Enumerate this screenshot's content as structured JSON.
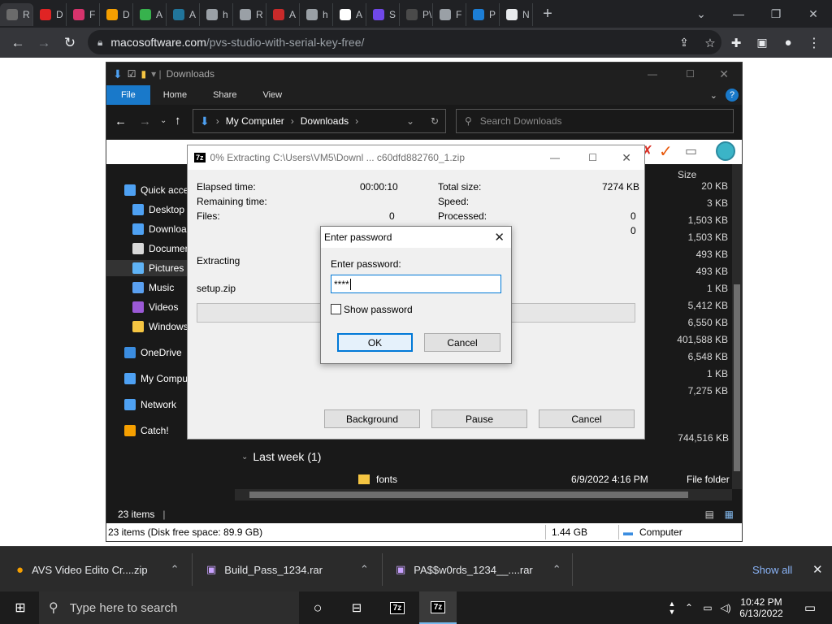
{
  "browser": {
    "tabs": [
      {
        "letter": "R",
        "color": "#6b6b6b"
      },
      {
        "letter": "D",
        "color": "#e02424"
      },
      {
        "letter": "F",
        "color": "#d6336c"
      },
      {
        "letter": "D",
        "color": "#f59f00"
      },
      {
        "letter": "A",
        "color": "#37b24d"
      },
      {
        "letter": "A",
        "color": "#21759b"
      },
      {
        "letter": "h",
        "color": "#9aa0a6"
      },
      {
        "letter": "R",
        "color": "#9aa0a6"
      },
      {
        "letter": "A",
        "color": "#c92a2a"
      },
      {
        "letter": "h",
        "color": "#9aa0a6"
      },
      {
        "letter": "A",
        "color": "#ffffff"
      },
      {
        "letter": "S",
        "color": "#7048e8"
      },
      {
        "letter": "P\\",
        "color": "#4a4a4a"
      },
      {
        "letter": "F",
        "color": "#9aa0a6"
      },
      {
        "letter": "P",
        "color": "#1c7ed6"
      },
      {
        "letter": "N",
        "color": "#e8eaed"
      }
    ],
    "new_tab": "+",
    "url_domain": "macosoftware.com",
    "url_path": "/pvs-studio-with-serial-key-free/"
  },
  "explorer": {
    "title": "Downloads",
    "ribbon": [
      "File",
      "Home",
      "Share",
      "View"
    ],
    "path": [
      "My Computer",
      "Downloads"
    ],
    "search_placeholder": "Search Downloads",
    "sidebar": [
      {
        "label": "Quick access",
        "color": "#4ea1f3"
      },
      {
        "label": "Desktop",
        "color": "#4ea1f3"
      },
      {
        "label": "Downloads",
        "color": "#4ea1f3"
      },
      {
        "label": "Documents",
        "color": "#d9d9d9"
      },
      {
        "label": "Pictures",
        "color": "#5fb3f6"
      },
      {
        "label": "Music",
        "color": "#5aa0f0"
      },
      {
        "label": "Videos",
        "color": "#9b59d6"
      },
      {
        "label": "Windows",
        "color": "#f5c542"
      },
      {
        "label": "OneDrive",
        "color": "#3b8de0"
      },
      {
        "label": "My Computer",
        "color": "#4ea1f3"
      },
      {
        "label": "Network",
        "color": "#4ea1f3"
      },
      {
        "label": "Catch!",
        "color": "#f59f00"
      }
    ],
    "size_header": "Size",
    "sizes": [
      "20 KB",
      "3 KB",
      "1,503 KB",
      "1,503 KB",
      "493 KB",
      "493 KB",
      "1 KB",
      "5,412 KB",
      "6,550 KB",
      "401,588 KB",
      "6,548 KB",
      "1 KB",
      "7,275 KB"
    ],
    "extra_size": "744,516 KB",
    "group_label": "Last week (1)",
    "folder_row": {
      "name": "fonts",
      "date": "6/9/2022 4:16 PM",
      "type": "File folder"
    },
    "status": "23 items",
    "status2": {
      "left": "23 items (Disk free space: 89.9 GB)",
      "size": "1.44 GB",
      "location": "Computer"
    }
  },
  "sevenzip": {
    "title": "0% Extracting C:\\Users\\VM5\\Downl ... c60dfd882760_1.zip",
    "elapsed_label": "Elapsed time:",
    "elapsed_value": "00:00:10",
    "remaining_label": "Remaining time:",
    "files_label": "Files:",
    "files_value": "0",
    "total_label": "Total size:",
    "total_value": "7274 KB",
    "speed_label": "Speed:",
    "processed_label": "Processed:",
    "processed_value": "0",
    "other_value": "0",
    "status": "Extracting",
    "current_file": "setup.zip",
    "progress": 0,
    "buttons": {
      "background": "Background",
      "pause": "Pause",
      "cancel": "Cancel"
    }
  },
  "password_dialog": {
    "title": "Enter password",
    "label": "Enter password:",
    "value": "****",
    "show_password": "Show password",
    "show_checked": false,
    "ok": "OK",
    "cancel": "Cancel"
  },
  "downloads_bar": {
    "items": [
      "AVS Video Edito Cr....zip",
      "Build_Pass_1234.rar",
      "PA$$w0rds_1234__....rar"
    ],
    "show_all": "Show all"
  },
  "taskbar": {
    "search_placeholder": "Type here to search",
    "time": "10:42 PM",
    "date": "6/13/2022",
    "app1": "7z",
    "app2": "7z"
  }
}
